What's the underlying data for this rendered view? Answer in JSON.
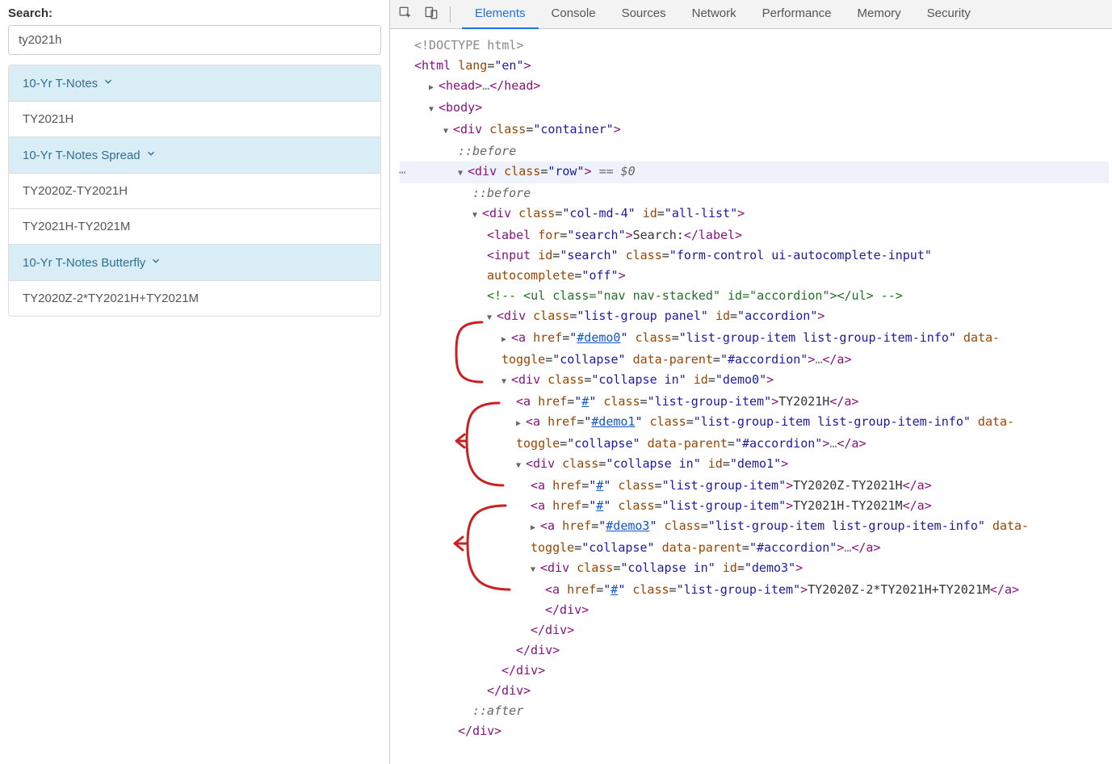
{
  "search": {
    "label": "Search:",
    "value": "ty2021h"
  },
  "accordion": {
    "groups": [
      {
        "header": "10-Yr T-Notes",
        "items": [
          "TY2021H"
        ]
      },
      {
        "header": "10-Yr T-Notes Spread",
        "items": [
          "TY2020Z-TY2021H",
          "TY2021H-TY2021M"
        ]
      },
      {
        "header": "10-Yr T-Notes Butterfly",
        "items": [
          "TY2020Z-2*TY2021H+TY2021M"
        ]
      }
    ]
  },
  "devtools": {
    "tabs": [
      "Elements",
      "Console",
      "Sources",
      "Network",
      "Performance",
      "Memory",
      "Security"
    ],
    "active_tab": 0
  },
  "dom": {
    "doctype": "<!DOCTYPE html>",
    "html_lang": "en",
    "body_text": "body",
    "container_class": "container",
    "before": "::before",
    "after": "::after",
    "row_class": "row",
    "eqvar": "== $0",
    "col_class": "col-md-4",
    "col_id": "all-list",
    "label_for": "search",
    "label_text": "Search:",
    "input_id": "search",
    "input_class": "form-control ui-autocomplete-input",
    "input_autocomplete": "off",
    "ul_comment": "<!-- <ul class=\"nav nav-stacked\" id=\"accordion\"></ul> -->",
    "listgroup_class": "list-group panel",
    "listgroup_id": "accordion",
    "a_info_class": "list-group-item list-group-item-info",
    "a_item_class": "list-group-item",
    "collapse_class": "collapse in",
    "data_toggle": "collapse",
    "data_parent": "#accordion",
    "href_hash": "#",
    "demo0": "#demo0",
    "demo0_id": "demo0",
    "demo0_item": "TY2021H",
    "demo1": "#demo1",
    "demo1_id": "demo1",
    "demo1_item1": "TY2020Z-TY2021H",
    "demo1_item2": "TY2021H-TY2021M",
    "demo3": "#demo3",
    "demo3_id": "demo3",
    "demo3_item": "TY2020Z-2*TY2021H+TY2021M"
  }
}
